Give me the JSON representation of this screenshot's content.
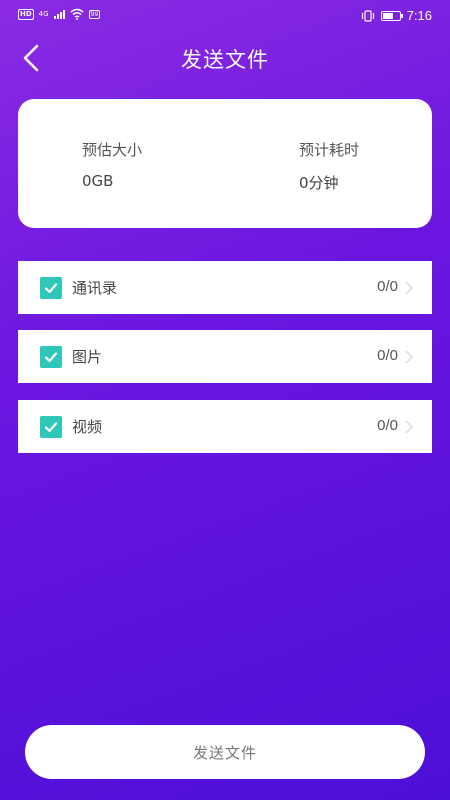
{
  "status_bar": {
    "hd": "HD",
    "network": "4G",
    "battery_badge": "99",
    "time": "7:16"
  },
  "header": {
    "title": "发送文件"
  },
  "summary": {
    "size_label": "预估大小",
    "size_value": "0GB",
    "time_label": "预计耗时",
    "time_value": "0分钟"
  },
  "items": [
    {
      "label": "通讯录",
      "count": "0/0",
      "checked": true
    },
    {
      "label": "图片",
      "count": "0/0",
      "checked": true
    },
    {
      "label": "视频",
      "count": "0/0",
      "checked": true
    }
  ],
  "actions": {
    "send_label": "发送文件"
  },
  "colors": {
    "gradient_start": "#8a2be2",
    "gradient_end": "#4c0fd6",
    "checkbox": "#2ec7b8"
  }
}
